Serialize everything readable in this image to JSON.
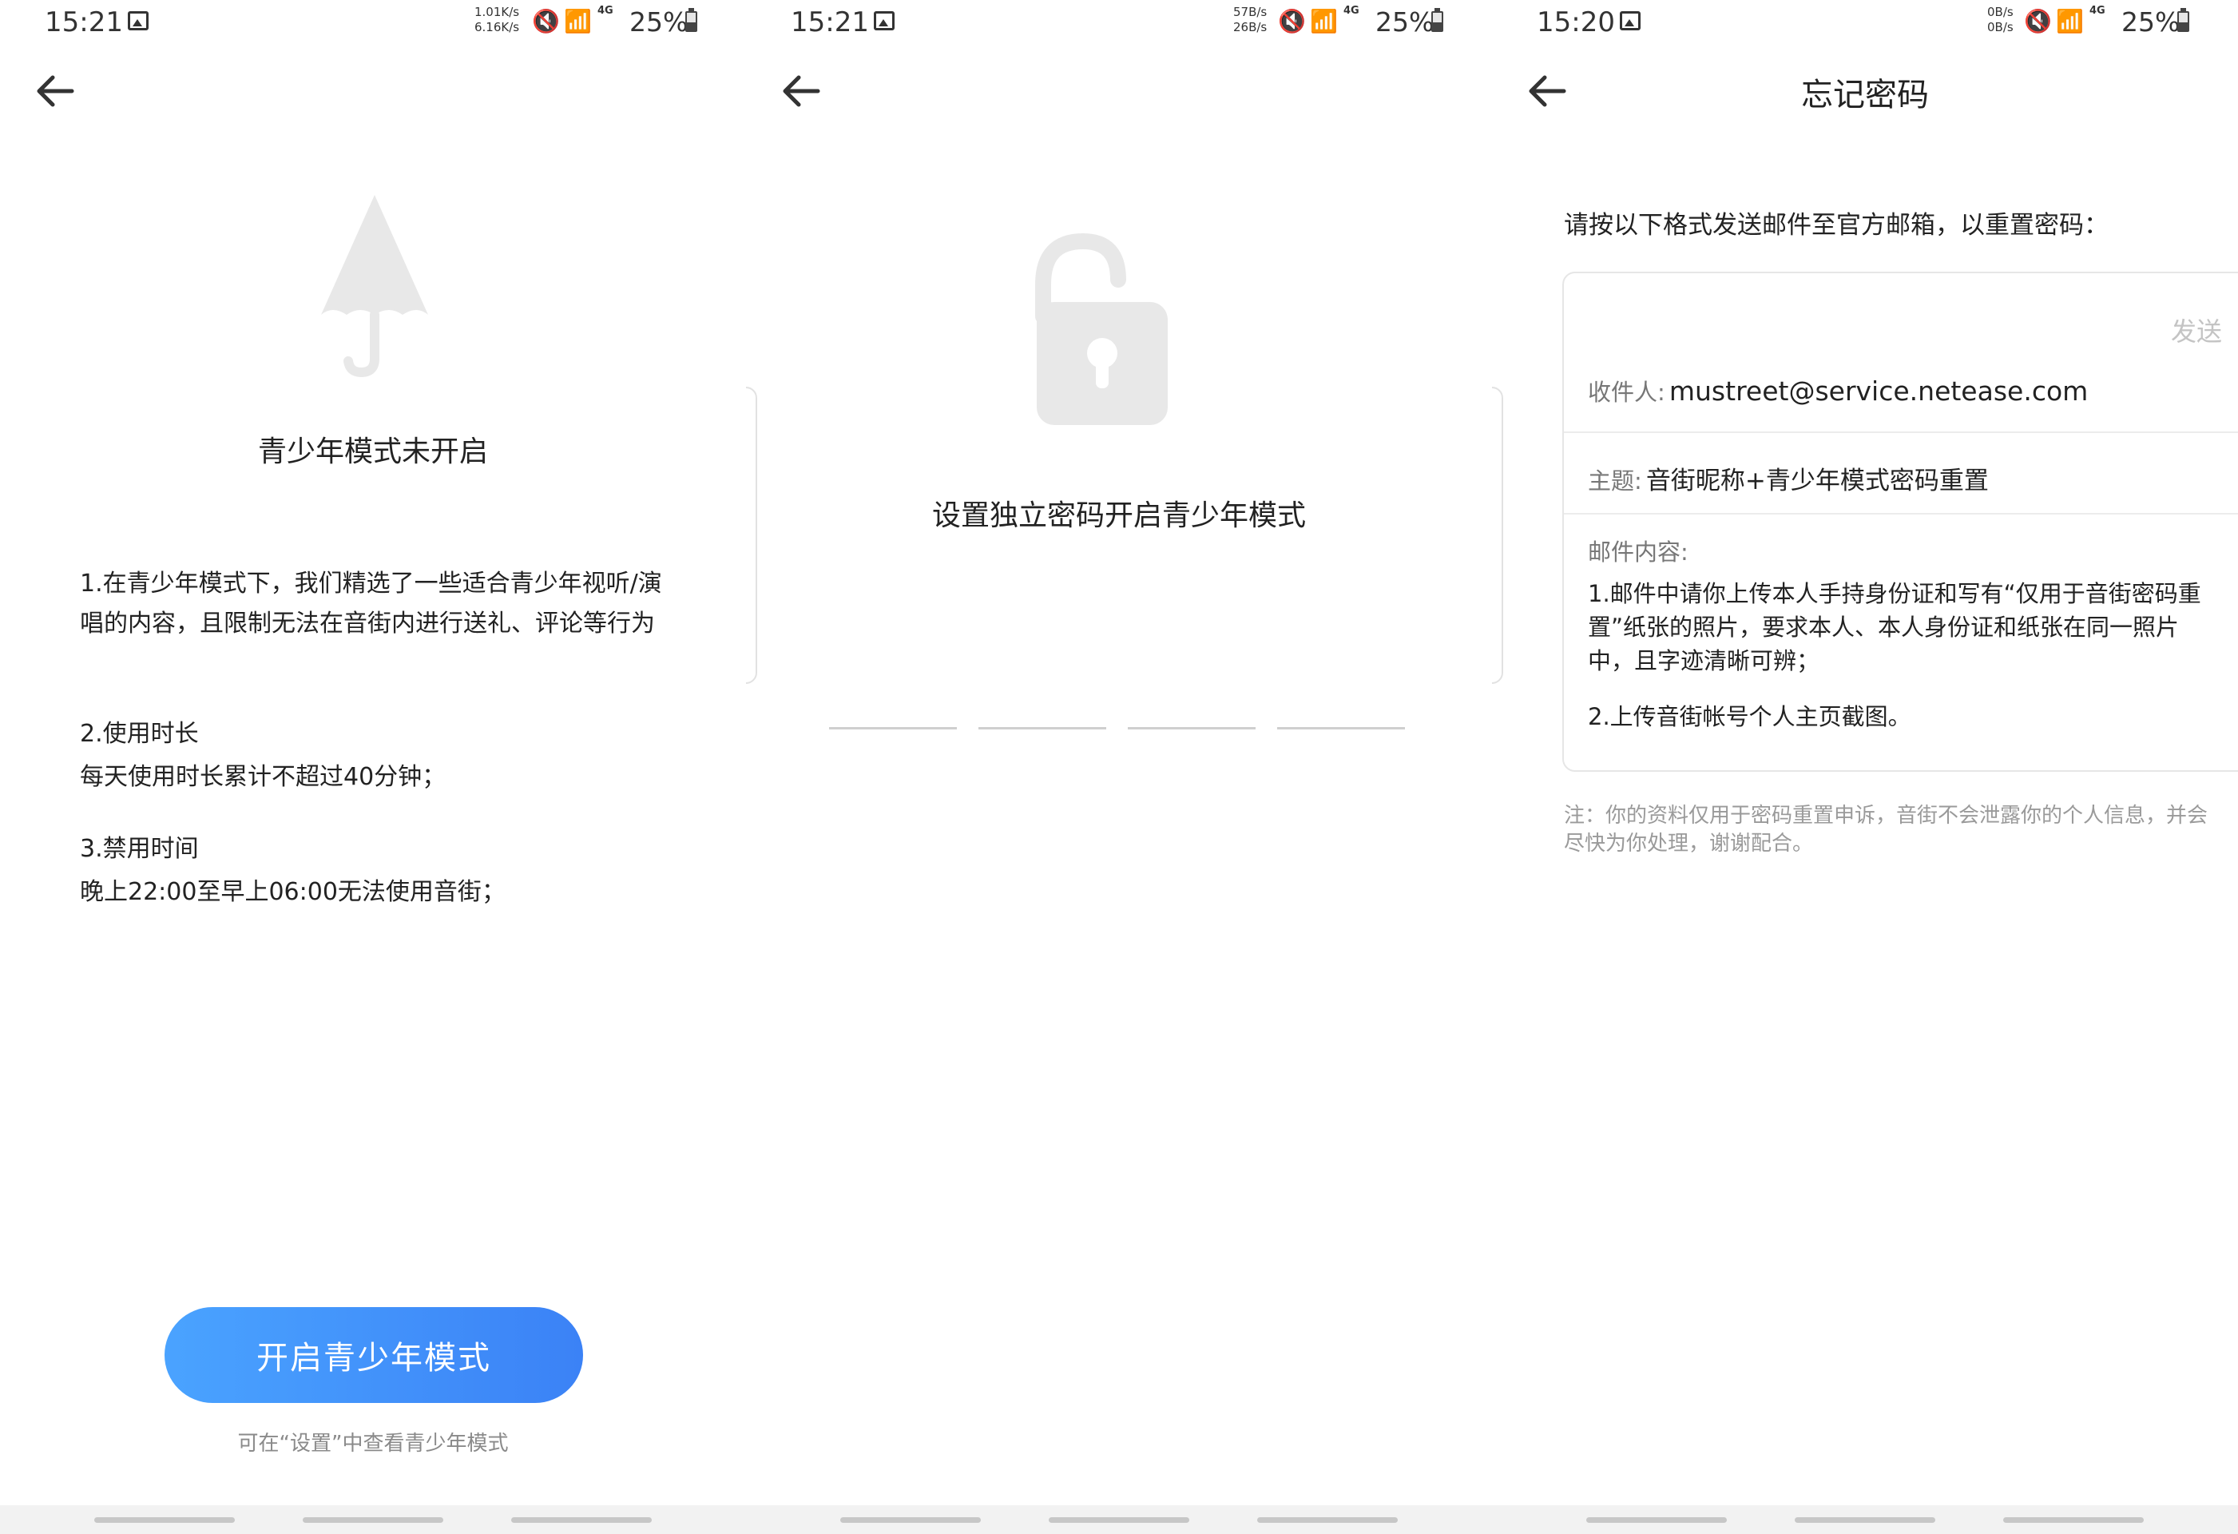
{
  "screen1": {
    "status": {
      "time": "15:21",
      "net_up": "1.01K/s",
      "net_down": "6.16K/s",
      "net_type": "4G",
      "battery": "25%"
    },
    "title": "青少年模式未开启",
    "rules": [
      {
        "text": "1.在青少年模式下，我们精选了一些适合青少年视听/演唱的内容，且限制无法在音街内进行送礼、评论等行为"
      },
      {
        "title": "2.使用时长",
        "text": "每天使用时长累计不超过40分钟；"
      },
      {
        "title": "3.禁用时间",
        "text": "晚上22:00至早上06:00无法使用音街；"
      }
    ],
    "button": "开启青少年模式",
    "hint": "可在“设置”中查看青少年模式"
  },
  "screen2": {
    "status": {
      "time": "15:21",
      "net_up": "57B/s",
      "net_down": "26B/s",
      "net_type": "4G",
      "battery": "25%"
    },
    "title": "设置独立密码开启青少年模式",
    "pin_slots": 4
  },
  "screen3": {
    "status": {
      "time": "15:20",
      "net_up": "0B/s",
      "net_down": "0B/s",
      "net_type": "4G",
      "battery": "25%"
    },
    "title": "忘记密码",
    "lead": "请按以下格式发送邮件至官方邮箱，以重置密码：",
    "send_label": "发送",
    "recipient_label": "收件人:",
    "recipient": "mustreet@service.netease.com",
    "subject_label": "主题:",
    "subject": "音街昵称+青少年模式密码重置",
    "content_label": "邮件内容:",
    "content_1": "1.邮件中请你上传本人手持身份证和写有“仅用于音街密码重置”纸张的照片，要求本人、本人身份证和纸张在同一照片中，且字迹清晰可辨；",
    "content_2": "2.上传音街帐号个人主页截图。",
    "note": "注：你的资料仅用于密码重置申诉，音街不会泄露你的个人信息，并会尽快为你处理，谢谢配合。"
  },
  "colors": {
    "accent_start": "#4aa3ff",
    "accent_end": "#3b82f6",
    "icon_gray": "#e8e8e8"
  }
}
